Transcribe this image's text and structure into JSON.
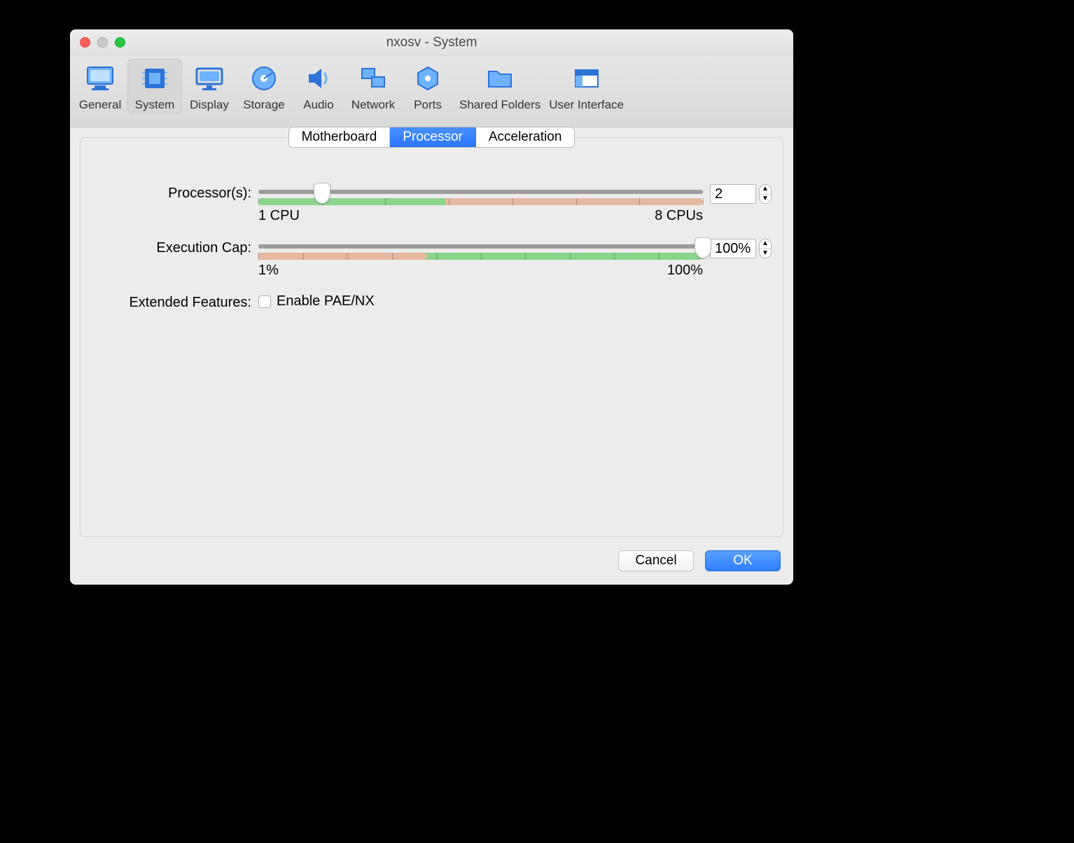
{
  "window": {
    "title": "nxosv - System"
  },
  "toolbar": {
    "items": [
      {
        "label": "General"
      },
      {
        "label": "System"
      },
      {
        "label": "Display"
      },
      {
        "label": "Storage"
      },
      {
        "label": "Audio"
      },
      {
        "label": "Network"
      },
      {
        "label": "Ports"
      },
      {
        "label": "Shared Folders"
      },
      {
        "label": "User Interface"
      }
    ],
    "selected": "System"
  },
  "tabs": {
    "items": [
      {
        "label": "Motherboard"
      },
      {
        "label": "Processor"
      },
      {
        "label": "Acceleration"
      }
    ],
    "active": "Processor"
  },
  "processor": {
    "processors_label": "Processor(s):",
    "processors_value": "2",
    "processors_min_label": "1 CPU",
    "processors_max_label": "8 CPUs",
    "processors_min": 1,
    "processors_max": 8,
    "exec_label": "Execution Cap:",
    "exec_value": "100%",
    "exec_min_label": "1%",
    "exec_max_label": "100%",
    "exec_min": 1,
    "exec_max": 100,
    "extended_label": "Extended Features:",
    "pae_label": "Enable PAE/NX",
    "pae_checked": false
  },
  "footer": {
    "cancel": "Cancel",
    "ok": "OK"
  }
}
